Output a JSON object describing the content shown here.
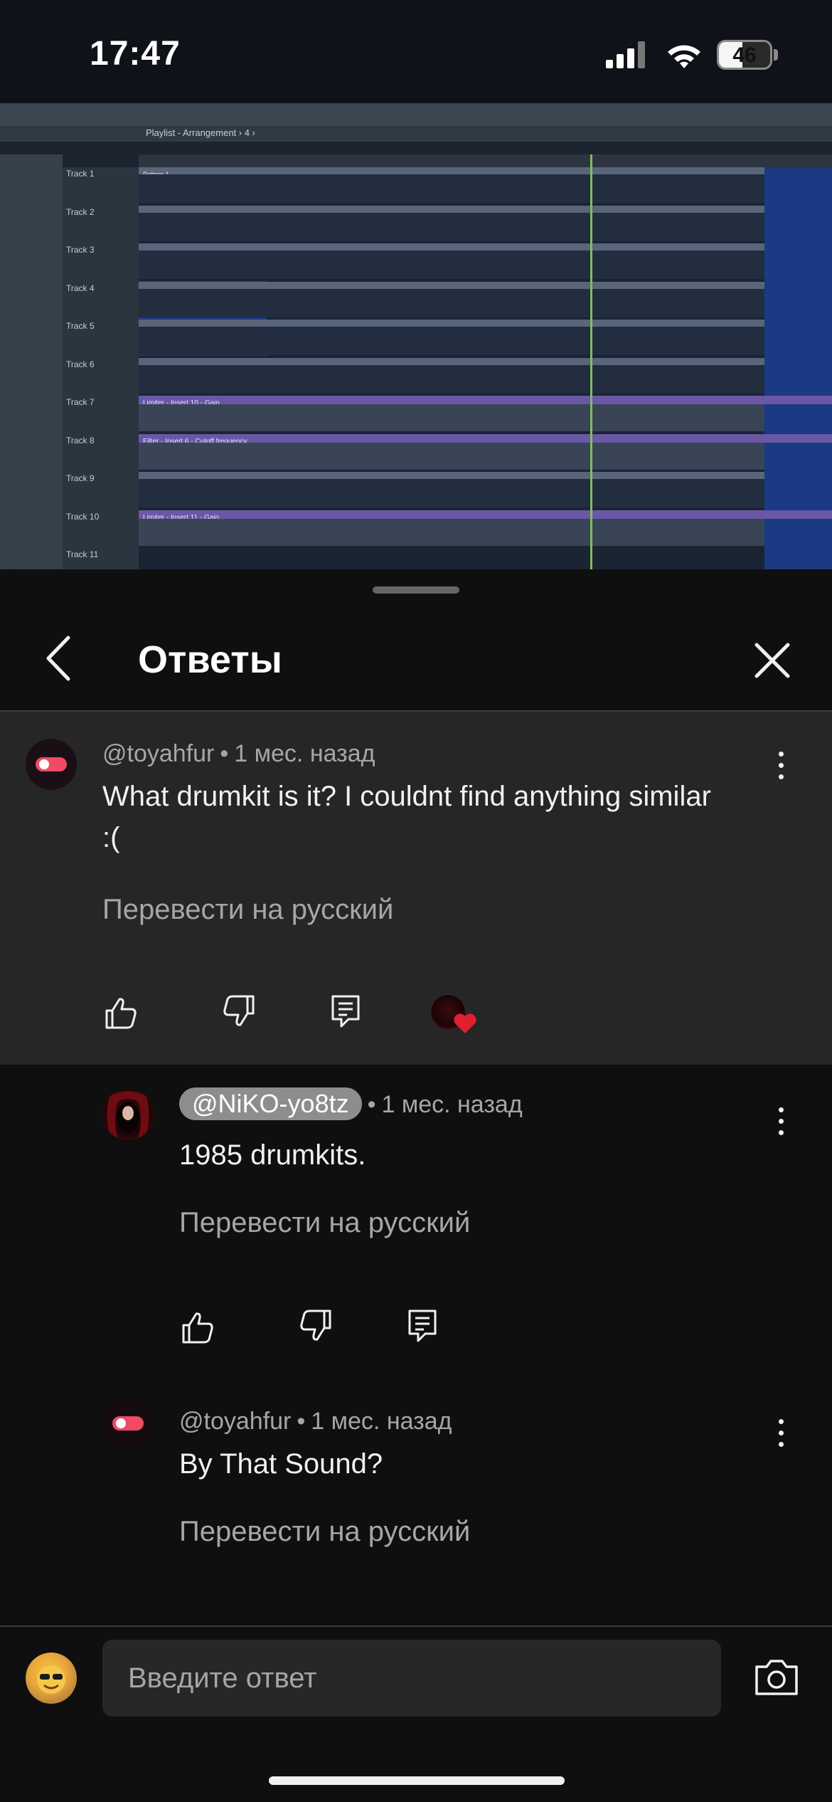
{
  "status_bar": {
    "time": "17:47",
    "battery_level": "46",
    "battery_fraction": 0.46
  },
  "video": {
    "playlist_title": "Playlist - Arrangement › 4 ›",
    "tracks": [
      "Track 1",
      "Track 2",
      "Track 3",
      "Track 4",
      "Track 5",
      "Track 6",
      "Track 7",
      "Track 8",
      "Track 9",
      "Track 10",
      "Track 11"
    ],
    "automation_labels": {
      "track7": "Limiter - Insert 10 - Gain",
      "track8": "Filter - Insert 6 - Cutoff frequency",
      "track10": "Limiter - Insert 11 - Gain"
    },
    "pattern_label": "Pattern 1"
  },
  "sheet": {
    "title": "Ответы"
  },
  "main_comment": {
    "author": "@toyahfur",
    "time": "1 мес. назад",
    "text_line1": "What drumkit is it? I couldnt find anything similar",
    "text_line2": ":(",
    "translate": "Перевести на русский"
  },
  "replies": [
    {
      "author": "@NiKO-yo8tz",
      "time": "1 мес. назад",
      "text": "1985 drumkits.",
      "translate": "Перевести на русский"
    },
    {
      "author": "@toyahfur",
      "time": "1 мес. назад",
      "text": "By That Sound?",
      "translate": "Перевести на русский"
    }
  ],
  "composer": {
    "placeholder": "Введите ответ"
  },
  "icons": {
    "back": "chevron-left-icon",
    "close": "close-icon",
    "like": "thumbs-up-icon",
    "dislike": "thumbs-down-icon",
    "reply": "reply-icon",
    "heart": "creator-heart-icon",
    "more": "more-vert-icon",
    "camera": "camera-icon"
  },
  "colors": {
    "background": "#0f0f0f",
    "highlight_comment_bg": "#262626",
    "heart": "#e0202e",
    "pill": "#f04a65"
  }
}
